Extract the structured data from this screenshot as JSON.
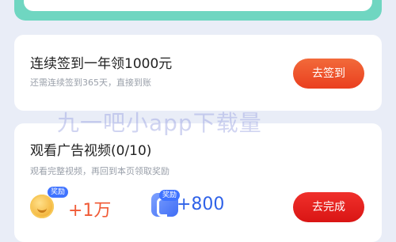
{
  "watermark": "九一吧小app下载量",
  "streak_task": {
    "title": "连续签到一年领1000元",
    "subtitle": "还需连续签到365天，直接到账",
    "button_label": "去签到"
  },
  "video_task": {
    "title": "观看广告视频(0/10)",
    "subtitle": "观看完整视频，再回到本页领取奖励",
    "button_label": "去完成",
    "rewards": [
      {
        "icon": "coin-icon",
        "tag": "奖励",
        "amount": "+1万"
      },
      {
        "icon": "card-icon",
        "tag": "奖励",
        "amount": "+800"
      }
    ]
  },
  "colors": {
    "background": "#e9edf7",
    "top_card_accent": "#6fd6c1",
    "primary_button": "#ea3f1f",
    "alt_button": "#d91514",
    "coin_amount": "#f05a36",
    "card_amount": "#2f62e8",
    "tag_blue": "#3f73ff"
  }
}
